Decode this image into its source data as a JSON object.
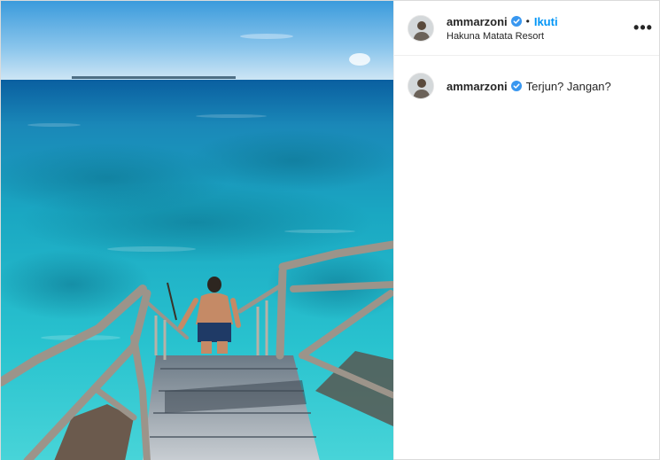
{
  "post": {
    "author": {
      "username": "ammarzoni",
      "verified": true,
      "follow_label": "Ikuti",
      "separator": "•",
      "location": "Hakuna Matata Resort",
      "more_label": "•••"
    },
    "caption": {
      "username": "ammarzoni",
      "verified": true,
      "text": "Terjun? Jangan?"
    },
    "colors": {
      "link_blue": "#0095f6",
      "verified_blue": "#3897f0",
      "text": "#262626",
      "border": "#dbdbdb"
    },
    "icons": {
      "verified": "verified-badge-icon",
      "more": "more-options-icon"
    }
  }
}
